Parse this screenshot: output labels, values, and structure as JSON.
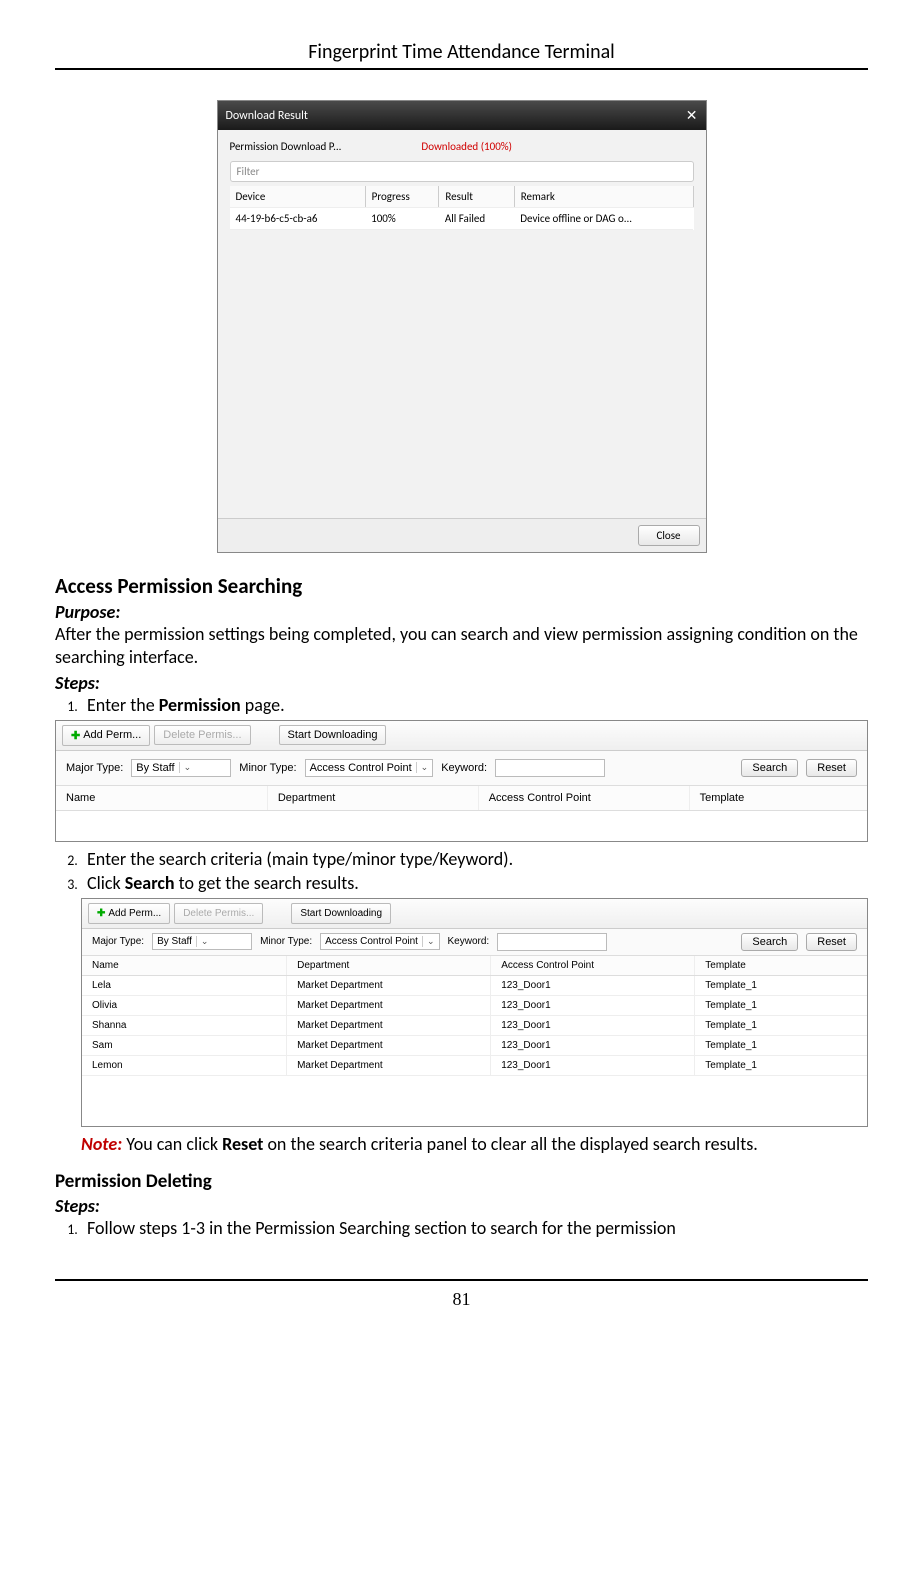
{
  "doc_header": "Fingerprint Time Attendance Terminal",
  "page_number": "81",
  "dialog": {
    "title": "Download Result",
    "status_label": "Permission Download P...",
    "status_value": "Downloaded (100%)",
    "filter_placeholder": "Filter",
    "columns": {
      "c1": "Device",
      "c2": "Progress",
      "c3": "Result",
      "c4": "Remark"
    },
    "row": {
      "device": "44-19-b6-c5-cb-a6",
      "progress": "100%",
      "result": "All Failed",
      "remark": "Device offline or DAG o..."
    },
    "close": "Close"
  },
  "section1": {
    "heading": "Access Permission Searching",
    "purpose_label": "Purpose:",
    "purpose_text": "After the permission settings being completed, you can search and view permission assigning condition on the searching interface.",
    "steps_label": "Steps:",
    "step1_a": "Enter the ",
    "step1_b": "Permission",
    "step1_c": " page.",
    "step2": "Enter the search criteria (main type/minor type/Keyword).",
    "step3_a": "Click ",
    "step3_b": "Search",
    "step3_c": " to get the search results.",
    "note_label": "Note:",
    "note_a": " You can click ",
    "note_b": "Reset",
    "note_c": " on the search criteria panel to clear all the displayed search results."
  },
  "perm_panel": {
    "add": "Add Perm...",
    "delete": "Delete Permis...",
    "start": "Start Downloading",
    "major_label": "Major Type:",
    "major_value": "By Staff",
    "minor_label": "Minor Type:",
    "minor_value": "Access Control Point",
    "keyword_label": "Keyword:",
    "search": "Search",
    "reset": "Reset",
    "col_name": "Name",
    "col_dept": "Department",
    "col_acp": "Access Control Point",
    "col_tmpl": "Template"
  },
  "perm_rows": [
    {
      "name": "Lela",
      "dept": "Market Department",
      "acp": "123_Door1",
      "tmpl": "Template_1"
    },
    {
      "name": "Olivia",
      "dept": "Market Department",
      "acp": "123_Door1",
      "tmpl": "Template_1"
    },
    {
      "name": "Shanna",
      "dept": "Market Department",
      "acp": "123_Door1",
      "tmpl": "Template_1"
    },
    {
      "name": "Sam",
      "dept": "Market Department",
      "acp": "123_Door1",
      "tmpl": "Template_1"
    },
    {
      "name": "Lemon",
      "dept": "Market Department",
      "acp": "123_Door1",
      "tmpl": "Template_1"
    }
  ],
  "section2": {
    "heading": "Permission Deleting",
    "steps_label": "Steps:",
    "step1": "Follow steps 1-3 in the Permission Searching section to search for the permission"
  }
}
